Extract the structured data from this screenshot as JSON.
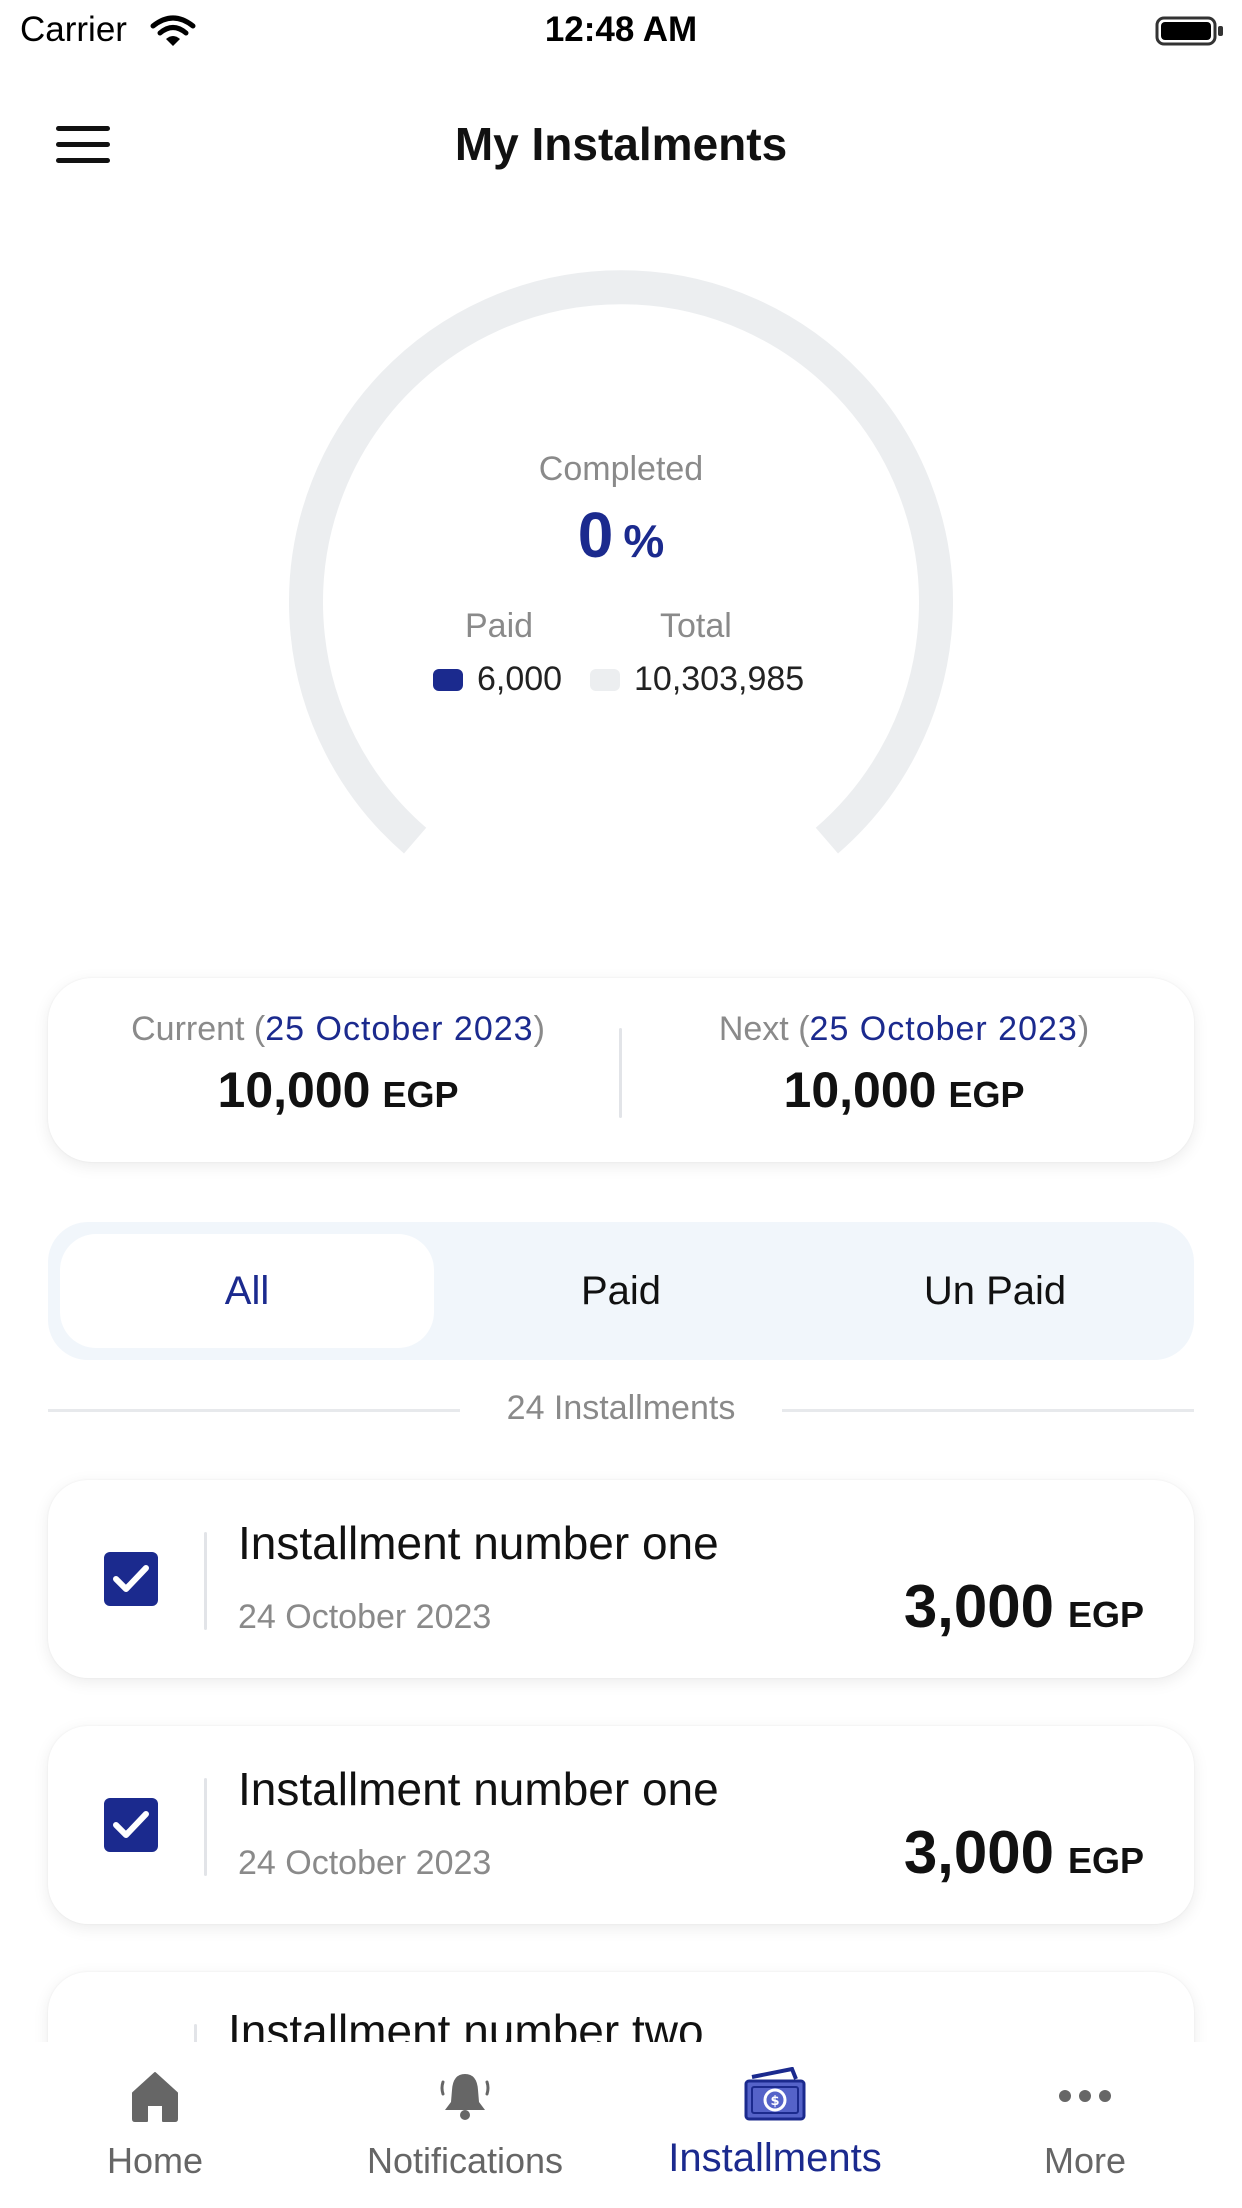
{
  "status_bar": {
    "carrier": "Carrier",
    "time": "12:48 AM"
  },
  "header": {
    "title": "My Instalments",
    "menu_icon": "hamburger-menu-icon"
  },
  "progress": {
    "completed_label": "Completed",
    "percent_value": "0",
    "percent_unit": "%",
    "completed_fraction": 0.0,
    "paid_label": "Paid",
    "total_label": "Total",
    "paid_value": "6,000",
    "total_value": "10,303,985"
  },
  "summary": {
    "current": {
      "label": "Current",
      "open": " (",
      "date": "25 October 2023",
      "close": ")",
      "amount": "10,000",
      "currency": "EGP"
    },
    "next": {
      "label": "Next",
      "open": " (",
      "date": "25 October 2023",
      "close": ")",
      "amount": "10,000",
      "currency": "EGP"
    }
  },
  "filter_tabs": {
    "all": "All",
    "paid": "Paid",
    "unpaid": "Un Paid",
    "selected": "All"
  },
  "list": {
    "count_label": "24 Installments",
    "items": [
      {
        "title": "Installment number one",
        "date": "24 October 2023",
        "amount": "3,000",
        "currency": "EGP",
        "checked": true
      },
      {
        "title": "Installment number one",
        "date": "24 October 2023",
        "amount": "3,000",
        "currency": "EGP",
        "checked": true
      },
      {
        "title": "Installment number two",
        "date": "",
        "amount": "",
        "currency": "",
        "checked": false
      }
    ]
  },
  "tabbar": {
    "home": "Home",
    "notifications": "Notifications",
    "installments": "Installments",
    "more": "More",
    "active": "Installments"
  },
  "colors": {
    "accent": "#1b2a8e",
    "track": "#eceef0",
    "muted_text": "#8a8a8a",
    "tabs_background": "#f1f6fb"
  }
}
